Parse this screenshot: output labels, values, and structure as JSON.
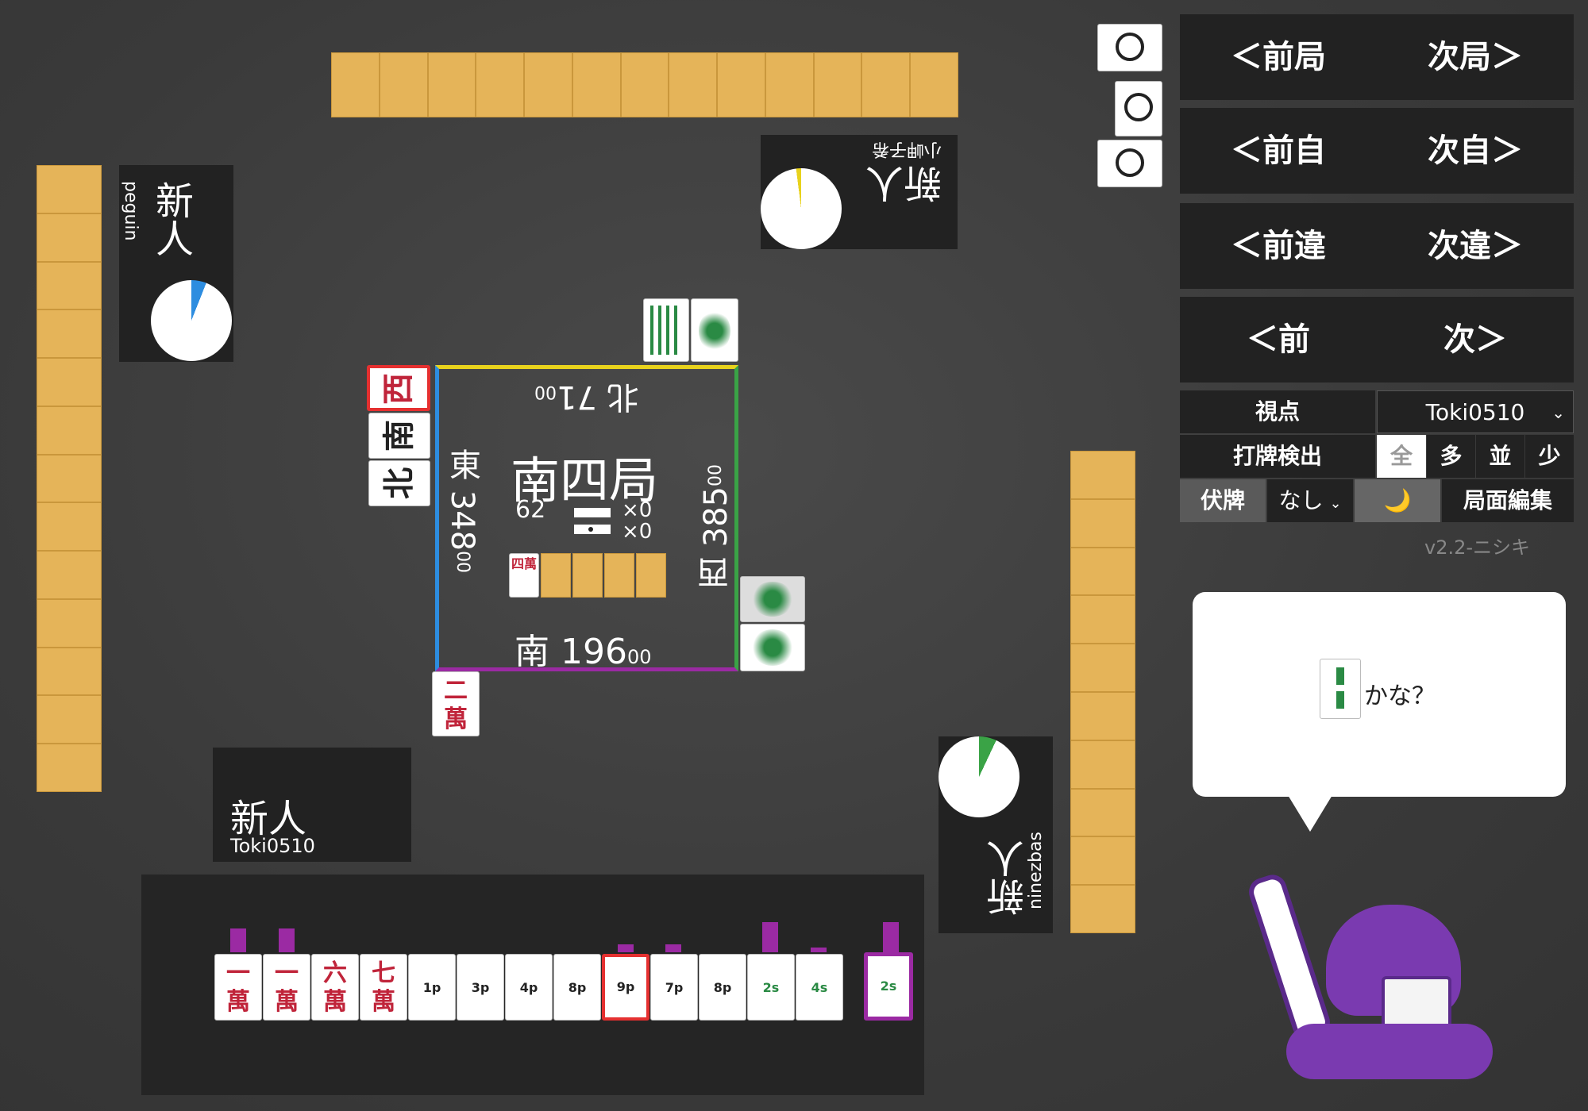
{
  "nav": {
    "prev_round": "＜前局",
    "next_round": "次局＞",
    "prev_self": "＜前自",
    "next_self": "次自＞",
    "prev_diff": "＜前違",
    "next_diff": "次違＞",
    "prev": "＜前",
    "next": "次＞"
  },
  "settings": {
    "viewpoint_label": "視点",
    "viewpoint_value": "Toki0510",
    "discard_detect_label": "打牌検出",
    "detect_options": [
      "全",
      "多",
      "並",
      "少"
    ],
    "hidden_label": "伏牌",
    "hidden_value": "なし",
    "moon_icon": "🌙",
    "edit_label": "局面編集",
    "version": "v2.2-ニシキ"
  },
  "speech": {
    "suggest_tile": "2s",
    "text": "かな？"
  },
  "center": {
    "round": "南四局",
    "remaining": "62",
    "counts": [
      "×0",
      "×0"
    ],
    "north_score": "北 71",
    "north_score_suffix": "00",
    "east_score": "東 348",
    "east_score_suffix": "00",
    "west_score": "西 385",
    "west_score_suffix": "00",
    "south_score": "南 196",
    "south_score_suffix": "00",
    "dora_tile": "四萬"
  },
  "players": {
    "self": {
      "rank": "新人",
      "name": "Toki0510"
    },
    "left": {
      "rank": "新人",
      "name": "peguin"
    },
    "top": {
      "rank": "新人",
      "name": "小岬子希"
    },
    "right": {
      "rank": "新人",
      "name": "ninezbas"
    }
  },
  "winds": [
    "西",
    "南",
    "北"
  ],
  "discards": {
    "self": "二萬"
  },
  "hand": [
    "一萬",
    "一萬",
    "六萬",
    "七萬",
    "1p",
    "3p",
    "4p",
    "8p",
    "9p",
    "7p",
    "8p",
    "2s",
    "4s"
  ],
  "draw_tile": "2s",
  "colors": {
    "accent": "#9b2aa3",
    "back": "#e5b459",
    "red": "#e53030"
  }
}
